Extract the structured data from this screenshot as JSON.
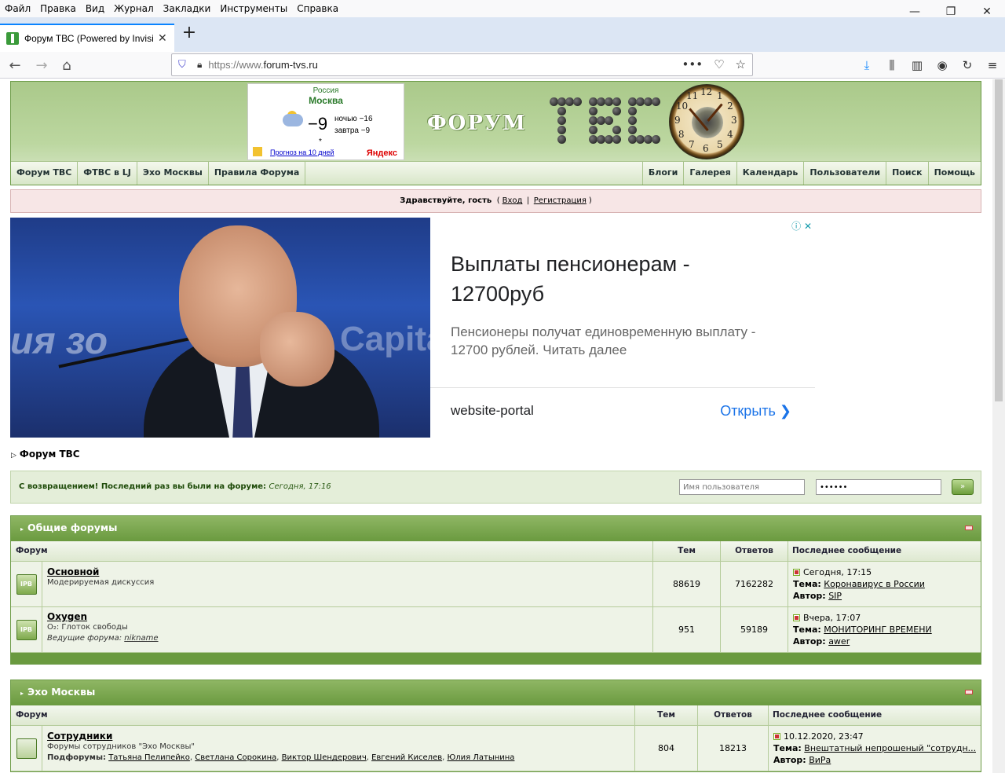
{
  "browser": {
    "menu": [
      "Файл",
      "Правка",
      "Вид",
      "Журнал",
      "Закладки",
      "Инструменты",
      "Справка"
    ],
    "tab_title": "Форум ТВС (Powered by Invision Power Board)",
    "url_prefix": "https://www.",
    "url_domain": "forum-tvs.ru"
  },
  "weather": {
    "region": "Россия",
    "city": "Москва",
    "temp": "−9",
    "night": "ночью −16",
    "tomorrow": "завтра −9",
    "star": "*",
    "forecast_link": "Прогноз на 10 дней",
    "brand": "Яндекс"
  },
  "header": {
    "logo_text": "ФОРУМ",
    "logo_letters": "ТВС",
    "clock_numbers": [
      "12",
      "1",
      "2",
      "3",
      "4",
      "5",
      "6",
      "7",
      "8",
      "9",
      "10",
      "11"
    ]
  },
  "topnav": {
    "left": [
      "Форум ТВС",
      "ФТВС в LJ",
      "Эхо Москвы",
      "Правила Форума"
    ],
    "right": [
      "Блоги",
      "Галерея",
      "Календарь",
      "Пользователи",
      "Поиск",
      "Помощь"
    ]
  },
  "userbar": {
    "greeting": "Здравствуйте, гость",
    "open": "(",
    "login": "Вход",
    "sep": "|",
    "register": "Регистрация",
    "close": ")"
  },
  "ad": {
    "bg_text": "ия зо",
    "bg_text2": "Capital",
    "headline": "Выплаты пенсионерам - 12700руб",
    "body": "Пенсионеры получат единовременную выплату - 12700 рублей. Читать далее",
    "site": "website-portal",
    "cta": "Открыть",
    "cta_arrow": "❯",
    "icons": "ⓘ ✕"
  },
  "breadcrumb": "Форум ТВС",
  "login": {
    "message": "С возвращением! Последний раз вы были на форуме:",
    "last_visit": "Сегодня, 17:16",
    "username_placeholder": "Имя пользователя",
    "password_value": "••••••",
    "go": "»"
  },
  "categories": [
    {
      "title": "Общие форумы",
      "cols": {
        "forum": "Форум",
        "topics": "Тем",
        "replies": "Ответов",
        "last": "Последнее сообщение"
      },
      "rows": [
        {
          "icon": "IPB",
          "name": "Основной",
          "desc": "Модерируемая дискуссия",
          "mods": "",
          "topics": "88619",
          "replies": "7162282",
          "date": "Сегодня, 17:15",
          "topic_label": "Тема:",
          "topic": "Коронавирус в России",
          "author_label": "Автор:",
          "author": "SIP"
        },
        {
          "icon": "IPB",
          "name": "Oxygen",
          "desc": "O₂: Глоток свободы",
          "mods_label": "Ведущие форума:",
          "mods": "nikname",
          "topics": "951",
          "replies": "59189",
          "date": "Вчера, 17:07",
          "topic_label": "Тема:",
          "topic": "МОНИТОРИНГ ВРЕМЕНИ",
          "author_label": "Автор:",
          "author": "awer"
        }
      ]
    },
    {
      "title": "Эхо Москвы",
      "cols": {
        "forum": "Форум",
        "topics": "Тем",
        "replies": "Ответов",
        "last": "Последнее сообщение"
      },
      "rows": [
        {
          "name": "Сотрудники",
          "desc": "Форумы сотрудников \"Эхо Москвы\"",
          "sub_label": "Подфорумы:",
          "subforums": [
            "Татьяна Пелипейко",
            "Светлана Сорокина",
            "Виктор Шендерович",
            "Евгений Киселев",
            "Юлия Латынина"
          ],
          "topics": "804",
          "replies": "18213",
          "date": "10.12.2020, 23:47",
          "topic_label": "Тема:",
          "topic": "Внештатный непрошеный \"сотрудн...",
          "author_label": "Автор:",
          "author": "ВиРа"
        }
      ]
    }
  ]
}
